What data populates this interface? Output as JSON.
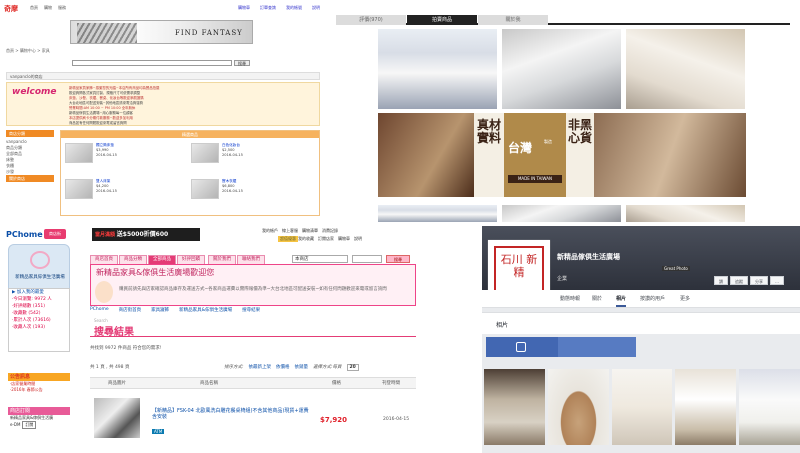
{
  "q1": {
    "logo": "奇摩",
    "top_links": [
      "首頁",
      "購物",
      "服務"
    ],
    "top_right_links": [
      "購物車",
      "訂單查詢",
      "我的帳號",
      "說明"
    ],
    "banner_text": "FIND FANTASY",
    "breadcrumb": "首頁 > 購物中心 > 家具",
    "search_button": "搜尋",
    "shop_bar": "vanpanclo的商店",
    "welcome_logo": "welcome",
    "welcome_lines": [
      "新精品家具家飾~感謝您的光臨~本店所有商品均為實品拍攝",
      "歡迎詢問各式家具訂製、規格尺寸可依需求調整",
      "床墊、沙發、衣櫃、餐桌、化妝台等歡迎參觀選購",
      "大台北地區可配送安裝~其他地區請來電洽詢運費",
      "營業時間:AM 10:00 ~ PM 10:00 全年無休",
      "新精品傢俱生活廣場~用心服務每一位顧客",
      "本店提供刷卡分期付款服務~歡迎多加利用",
      "商品如有任何問題歡迎來電或留言詢問"
    ],
    "side_header": "商店分類",
    "side_user": "vanpanclo",
    "side_rows": [
      "商品分類",
      "全部商品",
      "床墊",
      "衣櫃",
      "沙發"
    ],
    "side_header2": "關於商店",
    "main_header": "精選商品",
    "products": [
      {
        "name": "獨立筒床墊",
        "price": "$3,990",
        "date": "2016-04-15"
      },
      {
        "name": "白色化妝台",
        "price": "$2,500",
        "date": "2016-04-15"
      },
      {
        "name": "雙人床架",
        "price": "$4,200",
        "date": "2016-04-15"
      },
      {
        "name": "實木衣櫃",
        "price": "$6,800",
        "date": "2016-04-15"
      }
    ]
  },
  "q2": {
    "tabs": [
      "評價(970)",
      "拍賣商品",
      "關於我"
    ],
    "active_tab": 1,
    "banner": {
      "left_text": "真材實料",
      "map_text": "台灣",
      "map_sub": "製造",
      "made_in": "MADE IN TAIWAN",
      "right_text": "非黑心貨"
    }
  },
  "q3": {
    "logo": "PChome",
    "shop_badge": "商店街",
    "promo_text": "當月滿額",
    "promo_amount": "送$5000折價600",
    "top_links": [
      "我的帳戶",
      "線上客服",
      "購物清單",
      "消費記錄"
    ],
    "gift_badge": "超值優惠",
    "top_links2": [
      "我的收藏",
      "訂閱店家",
      "購物車",
      "說明"
    ],
    "side_card_title": "新精品家具傢俱生活廣場",
    "stats": [
      "▶ 加入我的最愛",
      "‧今日瀏覽: 9972 人",
      "‧好評總數 (351)",
      "‧收藏數 (542)",
      "‧累計人次 (73616)",
      "‧收藏人次 (193)"
    ],
    "notice_header": "公告訊息",
    "notice_rows": [
      "‧店家營業時間",
      "‧2016年 春節公告"
    ],
    "news_header": "商店訂閱",
    "news_rows": [
      "新精品家具&傢俱生活廣",
      "e-DM"
    ],
    "subscribe_btn": "訂閱",
    "nav": [
      "商店首頁",
      "商品分類",
      "全部商品",
      "好評回饋"
    ],
    "nav2": [
      "關於我們",
      "聯絡我們",
      "付款方式"
    ],
    "search_select": "本商店",
    "search_btn": "搜尋",
    "store_title": "新精品家具&傢俱生活廣場歡迎您",
    "store_sub": "購買前請先與店家確認商品庫存及運送方式~各家商品運費以實際報價為準~大台北地區可配送安裝~如有任何問題歡迎來電或留言詢問",
    "crumbs": [
      "PChome",
      "商店街首頁",
      "家具寢飾",
      "新精品家具&傢俱生活廣場",
      "搜尋結果"
    ],
    "results_title": "搜尋結果",
    "results_sub": "Search",
    "count_text": "共找到 9972 件商品  符合您的需求!",
    "page_text": "共 1 頁 , 共 498 頁",
    "sort_label": "排序方式:",
    "sort_opts": [
      "依最新上架",
      "依價格",
      "依銷量"
    ],
    "per_page_label": "選擇方式:每頁",
    "per_page_val": "20",
    "col_headers": [
      "商品圖片",
      "商品名稱",
      "價格",
      "刊登時間"
    ],
    "row": {
      "title": "【新精品】FSK-04 北歐風洗白雕花餐桌椅組(不含其他商品)現貨+運費含安裝",
      "atm_badge": "ATM",
      "price": "$7,920",
      "date": "2016-04-15"
    }
  },
  "q4": {
    "avatar_text": "石川 新精",
    "page_name": "新精品傢俱生活廣場",
    "category": "企業",
    "tooltip": "Great Photo",
    "buttons": [
      "讚",
      "追蹤",
      "分享",
      "…"
    ],
    "tabs": [
      "動態時報",
      "關於",
      "相片",
      "按讚的用戶",
      "更多"
    ],
    "active_tab": 2,
    "photos_header": "相片"
  }
}
